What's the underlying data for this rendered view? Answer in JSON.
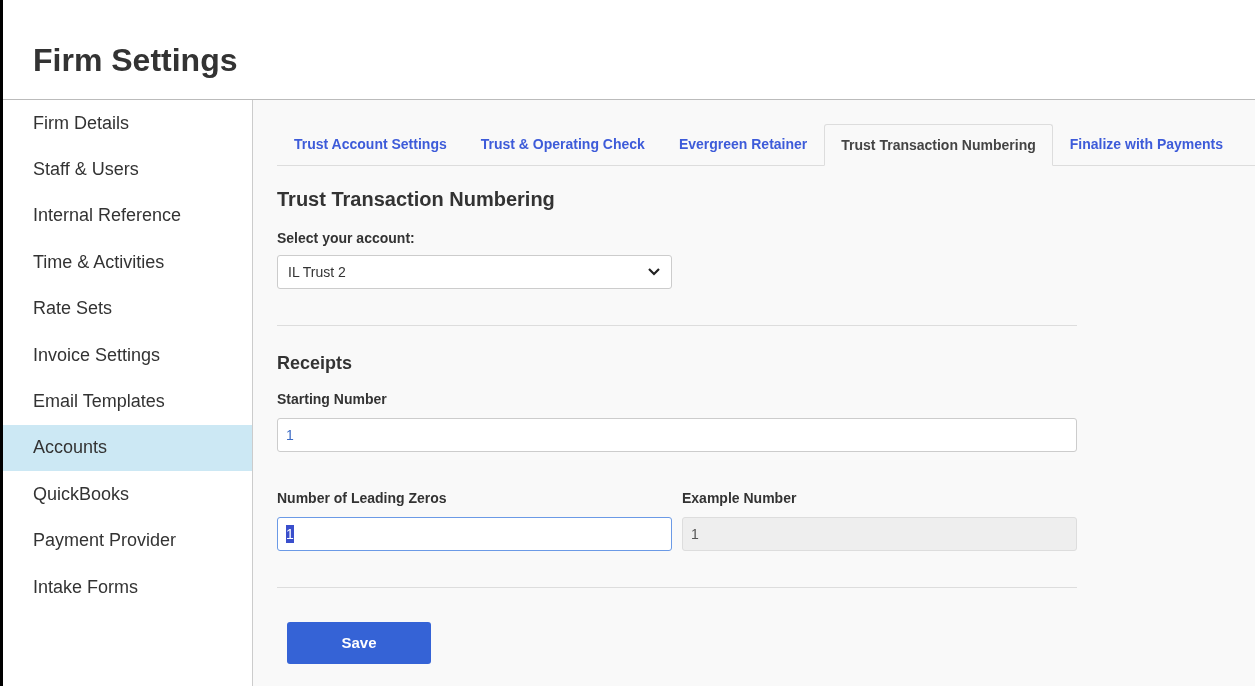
{
  "page": {
    "title": "Firm Settings"
  },
  "sidebar": {
    "items": [
      {
        "label": "Firm Details",
        "selected": false
      },
      {
        "label": "Staff & Users",
        "selected": false
      },
      {
        "label": "Internal Reference",
        "selected": false
      },
      {
        "label": "Time & Activities",
        "selected": false
      },
      {
        "label": "Rate Sets",
        "selected": false
      },
      {
        "label": "Invoice Settings",
        "selected": false
      },
      {
        "label": "Email Templates",
        "selected": false
      },
      {
        "label": "Accounts",
        "selected": true
      },
      {
        "label": "QuickBooks",
        "selected": false
      },
      {
        "label": "Payment Provider",
        "selected": false
      },
      {
        "label": "Intake Forms",
        "selected": false
      }
    ]
  },
  "tabs": [
    {
      "label": "Trust Account Settings",
      "selected": false
    },
    {
      "label": "Trust & Operating Check",
      "selected": false
    },
    {
      "label": "Evergreen Retainer",
      "selected": false
    },
    {
      "label": "Trust Transaction Numbering",
      "selected": true
    },
    {
      "label": "Finalize with Payments",
      "selected": false
    }
  ],
  "section": {
    "title": "Trust Transaction Numbering",
    "account": {
      "label": "Select your account:",
      "value": "IL Trust 2"
    }
  },
  "receipts": {
    "title": "Receipts",
    "starting_number": {
      "label": "Starting Number",
      "value": "1",
      "focused": false,
      "disabled": false
    },
    "leading_zeros": {
      "label": "Number of Leading Zeros",
      "value": "1",
      "focused": true,
      "disabled": false
    },
    "example_number": {
      "label": "Example Number",
      "value": "1",
      "disabled": true
    }
  },
  "save_button": {
    "label": "Save"
  }
}
